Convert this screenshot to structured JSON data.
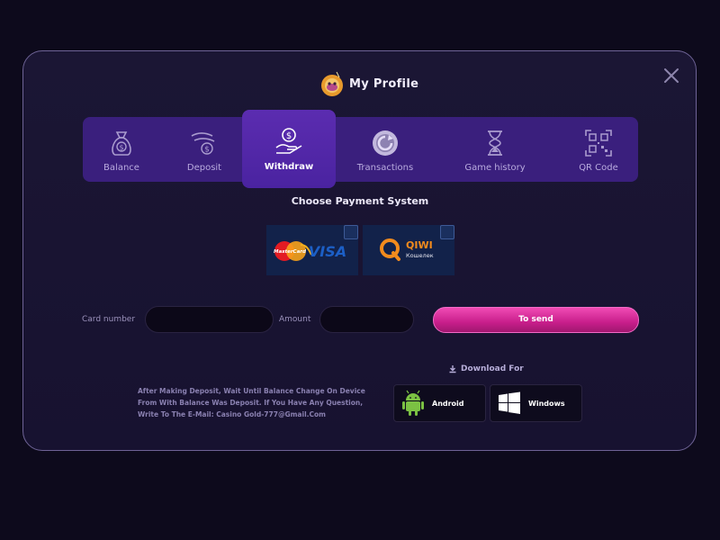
{
  "header": {
    "title": "My Profile"
  },
  "tabs": [
    {
      "label": "Balance",
      "icon": "money-bag-icon"
    },
    {
      "label": "Deposit",
      "icon": "deposit-hand-icon"
    },
    {
      "label": "Withdraw",
      "icon": "withdraw-hand-icon",
      "active": true
    },
    {
      "label": "Transactions",
      "icon": "transactions-icon"
    },
    {
      "label": "Game history",
      "icon": "hourglass-icon"
    },
    {
      "label": "QR Code",
      "icon": "qr-code-icon"
    }
  ],
  "payment": {
    "title": "Choose Payment System",
    "options": [
      {
        "brand1": "MasterCard",
        "brand2": "VISA"
      },
      {
        "brand1": "QIWI",
        "brand2": "Кошелек"
      }
    ]
  },
  "form": {
    "card_label": "Card number",
    "card_value": "",
    "amount_label": "Amount",
    "amount_value": "",
    "send_label": "To send"
  },
  "info_text": "After Making Deposit, Wait Until Balance Change On Device From With Balance Was Deposit. If You Have Any Question, Write To The E-Mail: Casino Gold-777@Gmail.Com",
  "download": {
    "title": "Download For",
    "android_label": "Android",
    "windows_label": "Windows"
  },
  "colors": {
    "accent": "#e0399f",
    "tabs_bg": "#3a1f7d",
    "tab_active": "#5b2cb0",
    "modal_border": "#6e6396"
  }
}
